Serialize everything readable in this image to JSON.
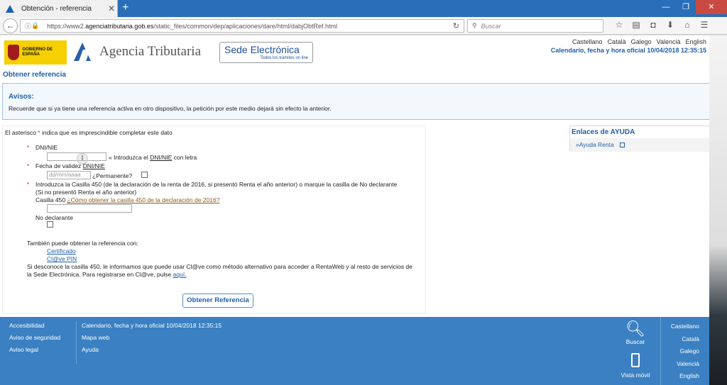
{
  "browser": {
    "tab_title": "Obtención - referencia",
    "tab_close": "✕",
    "new_tab": "+",
    "url_prefix": "https://www2.",
    "url_host": "agenciatributaria.gob.es",
    "url_path": "/static_files/common/dep/aplicaciones/dare/html/dabjObtRef.html",
    "search_placeholder": "Buscar"
  },
  "header": {
    "gov_logo_text": "GOBIERNO DE ESPAÑA",
    "agency_name": "Agencia Tributaria",
    "sede_title": "Sede Electrónica",
    "sede_subtitle": "Todos los trámites on line",
    "languages": [
      "Castellano",
      "Català",
      "Galego",
      "Valencià",
      "English"
    ],
    "datetime": "Calendario, fecha y hora oficial 10/04/2018 12:35:15"
  },
  "page_title": "Obtener referencia",
  "avisos": {
    "heading": "Avisos:",
    "text": "Recuerde que si ya tiene una referencia activa en otro dispositivo, la petición por este medio dejará sin efecto la anterior."
  },
  "form": {
    "required_note_a": "El asterisco ",
    "required_note_b": "* ",
    "required_note_c": "indica que es imprescindible completar este dato",
    "dni_label": "DNI/NIE",
    "dni_hint_a": "« Introduzca el ",
    "dni_hint_b": "DNI/NIE",
    "dni_hint_c": " con letra",
    "fecha_label_a": "Fecha de validez ",
    "fecha_label_b": "DNI/NIE",
    "fecha_placeholder": "dd/mm/aaaa",
    "permanente_label": "¿Permanente?",
    "casilla_text": "Introduzca la Casilla 450 (de la declaración de la renta de 2016, si presentó Renta el año anterior) o marque la casilla de No declarante (Si no presentó Renta el año anterior)",
    "casilla_label": "Casilla 450",
    "casilla_link": "¿Cómo obtener la casilla 450 de la declaración de 2016?",
    "no_declarante_label": "No declarante",
    "alt_intro": "También puede obtener la referencia con:",
    "alt_link_1": "Certificado",
    "alt_link_2": "Cl@ve PIN",
    "clave_text": "Si desconoce la casilla 450, le informamos que puede usar Cl@ve como método alternativo para acceder a RentaWeb y al resto de servicios de la Sede Electrónica. Para registrarse en Cl@ve, pulse ",
    "clave_link": "aquí.",
    "submit_label": "Obtener Referencia"
  },
  "help": {
    "heading": "Enlaces de AYUDA",
    "link": "»Ayuda Renta"
  },
  "footer": {
    "col1": [
      "Accesibilidad",
      "Aviso de seguridad",
      "Aviso legal"
    ],
    "col2": [
      "Calendario, fecha y hora oficial 10/04/2018 12:35:15",
      "Mapa web",
      "Ayuda"
    ],
    "search_label": "Buscar",
    "mobile_label": "Vista móvil",
    "languages": [
      "Castellano",
      "Català",
      "Galego",
      "Valencià",
      "English"
    ]
  }
}
